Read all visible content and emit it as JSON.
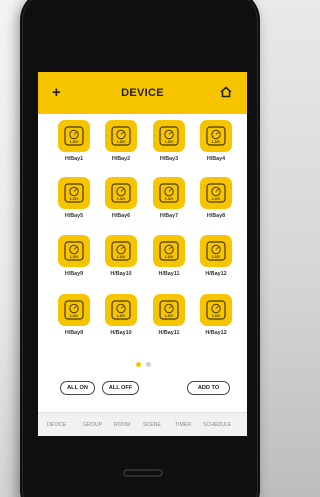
{
  "header": {
    "title": "DEVICE",
    "add_icon": "plus-icon",
    "home_icon": "home-icon",
    "add_glyph": "+"
  },
  "devices": [
    {
      "label": "H/Bay1"
    },
    {
      "label": "H/Bay2"
    },
    {
      "label": "H/Bay3"
    },
    {
      "label": "H/Bay4"
    },
    {
      "label": "H/Bay5"
    },
    {
      "label": "H/Bay6"
    },
    {
      "label": "H/Bay7"
    },
    {
      "label": "H/Bay8"
    },
    {
      "label": "H/Bay9"
    },
    {
      "label": "H/Bay10"
    },
    {
      "label": "H/Bay11"
    },
    {
      "label": "H/Bay12"
    },
    {
      "label": "H/Bay9"
    },
    {
      "label": "H/Bay10"
    },
    {
      "label": "H/Bay11"
    },
    {
      "label": "H/Bay12"
    }
  ],
  "device_tile_text": "1-10V",
  "pagination": {
    "pages": 2,
    "current": 1
  },
  "actions": {
    "all_on": "ALL ON",
    "all_off": "ALL OFF",
    "add_to": "ADD TO"
  },
  "tabs": [
    {
      "label": "DEVICE",
      "active": true
    },
    {
      "label": "GROUP",
      "active": false
    },
    {
      "label": "ROOM",
      "active": false
    },
    {
      "label": "SCENE",
      "active": false
    },
    {
      "label": "TIMER",
      "active": false
    },
    {
      "label": "SCHEDULE",
      "active": false
    }
  ],
  "colors": {
    "accent": "#f6c500",
    "dot_active": "#f6c500",
    "dot_inactive": "#cfcfcf"
  }
}
